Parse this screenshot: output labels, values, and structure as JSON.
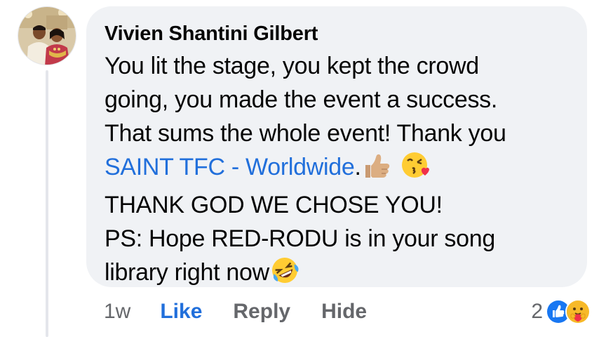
{
  "comment": {
    "author": "Vivien Shantini Gilbert",
    "lines": [
      "You lit the stage, you kept the crowd",
      "going, you made the event a success.",
      "That sums the whole event! Thank you"
    ],
    "mention": "SAINT TFC - Worldwide",
    "mention_suffix": ".",
    "line_after_mention": "THANK GOD WE CHOSE YOU!",
    "ps_line_1": "PS: Hope RED-RODU is in your song",
    "ps_line_2": "library right now",
    "emojis": [
      "thumbs-up-icon",
      "kissing-heart-icon",
      "rolling-laughing-icon"
    ]
  },
  "actions": {
    "time": "1w",
    "like": "Like",
    "reply": "Reply",
    "hide": "Hide"
  },
  "reactions": {
    "count": "2",
    "types": [
      "like-reaction-icon",
      "care-reaction-icon"
    ]
  },
  "colors": {
    "bubble": "#f0f2f5",
    "link": "#216fdb",
    "muted": "#65676b",
    "text": "#050505"
  }
}
